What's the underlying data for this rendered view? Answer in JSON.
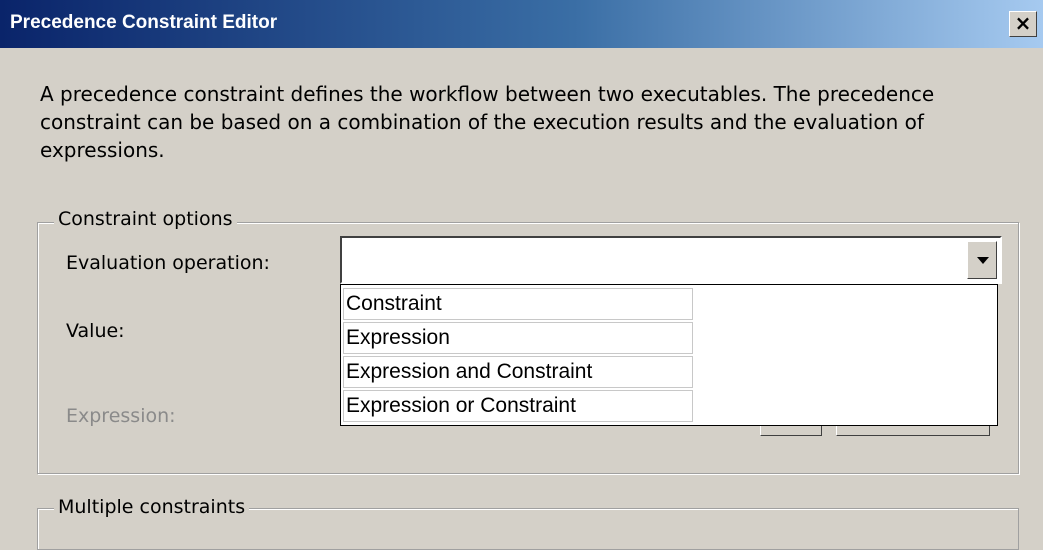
{
  "window": {
    "title": "Precedence Constraint Editor",
    "close_glyph": "×"
  },
  "description": "A precedence constraint defines the workflow between two executables. The precedence constraint can be based on a combination of the execution results and the evaluation of expressions.",
  "constraint_options": {
    "legend": "Constraint options",
    "evaluation_operation_label": "Evaluation operation:",
    "evaluation_operation_value": "",
    "value_label": "Value:",
    "expression_label": "Expression:",
    "dropdown_icon": "chevron-down-icon",
    "options": [
      "Constraint",
      "Expression",
      "Expression and Constraint",
      "Expression or Constraint"
    ]
  },
  "multiple_constraints": {
    "legend": "Multiple constraints"
  },
  "colors": {
    "titlebar_start": "#0a246a",
    "titlebar_end": "#a6caf0",
    "dialog_bg": "#d4d0c8"
  }
}
